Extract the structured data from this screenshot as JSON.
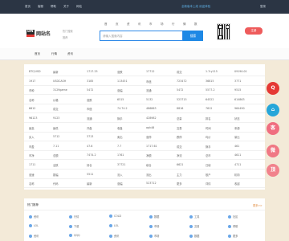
{
  "topbar": {
    "left": [
      "首页",
      "客服",
      "帮助",
      "关于",
      "网站"
    ],
    "promo": "全新版本上线 欢迎体验",
    "right": "登录"
  },
  "header": {
    "logo_mark": "DN",
    "logo_name": "网站名",
    "logo_sub": [
      "热门搜索",
      "推荐"
    ],
    "nav": [
      "首",
      "页",
      "资",
      "讯",
      "市",
      "场",
      "行",
      "情",
      "数",
      "据",
      "工",
      "具"
    ],
    "search_placeholder": "请输入搜索内容",
    "search_button": "搜索",
    "red_button": "注册"
  },
  "subnav": [
    "首页",
    "行情",
    "资讯"
  ],
  "table": [
    [
      "BTC/USD",
      "最新",
      "1717.25",
      "涨跌",
      "17712",
      "成交",
      "1.7ry115",
      "09190.01"
    ],
    [
      "1917",
      "USDCASH",
      "3185",
      "113451",
      "市值",
      "723472",
      "36815",
      "3771"
    ],
    [
      "币种",
      "3129game",
      "5472",
      "涨幅",
      "流通",
      "5472",
      "5577.2",
      "9515"
    ],
    [
      "名称",
      "价格",
      "涨跌",
      "6515",
      "5132",
      "523715",
      "64522",
      "614863"
    ],
    [
      "6612",
      "成交",
      "市值",
      "74.74.2",
      "486863",
      "8816",
      "7612",
      "964490"
    ],
    [
      "96123",
      "9123",
      "流通",
      "换手",
      "428982",
      "总量",
      "排名",
      "状态"
    ],
    [
      "最高",
      "最低",
      "开盘",
      "收盘",
      "apk46",
      "交易",
      "时间",
      "来源"
    ],
    [
      "买入",
      "5712",
      "3713",
      "卖出",
      "涨停",
      "跌停",
      "均价",
      "量比"
    ],
    [
      "市盈",
      "7.11",
      "47.6",
      "7.7",
      "1717.61",
      "成交",
      "换手",
      "461"
    ],
    [
      "市净",
      "总额",
      "7474.2",
      "1761",
      "净额",
      "净流",
      "总市",
      "4611"
    ],
    [
      "1711",
      "活跃",
      "持仓",
      "37721",
      "增仓",
      "6621",
      "日增",
      "4711"
    ],
    [
      "涨速",
      "振幅",
      "5511",
      "流入",
      "流出",
      "主力",
      "散户",
      "机构"
    ],
    [
      "名称",
      "代码",
      "最新",
      "涨幅",
      "523712",
      "更多",
      "详情",
      "收起"
    ]
  ],
  "bottom": {
    "title": "热门推荐",
    "more": "更多>>",
    "items": [
      [
        "资讯",
        "行情",
        "COLD",
        "数据",
        "工具",
        "社区"
      ],
      [
        "LOL",
        "下载",
        "LOL",
        "市场",
        "交易",
        "帮助"
      ],
      [
        "资讯",
        "QQQ",
        "资讯",
        "市场",
        "数据",
        "更多"
      ]
    ]
  },
  "floats": [
    {
      "label": "Q",
      "color": "#e53935"
    },
    {
      "label": "⌂",
      "color": "#26a6d9"
    },
    {
      "label": "客",
      "color": "#f06e80"
    },
    {
      "label": "微",
      "color": "#f07884"
    },
    {
      "label": "顶",
      "color": "#f1828c"
    }
  ]
}
